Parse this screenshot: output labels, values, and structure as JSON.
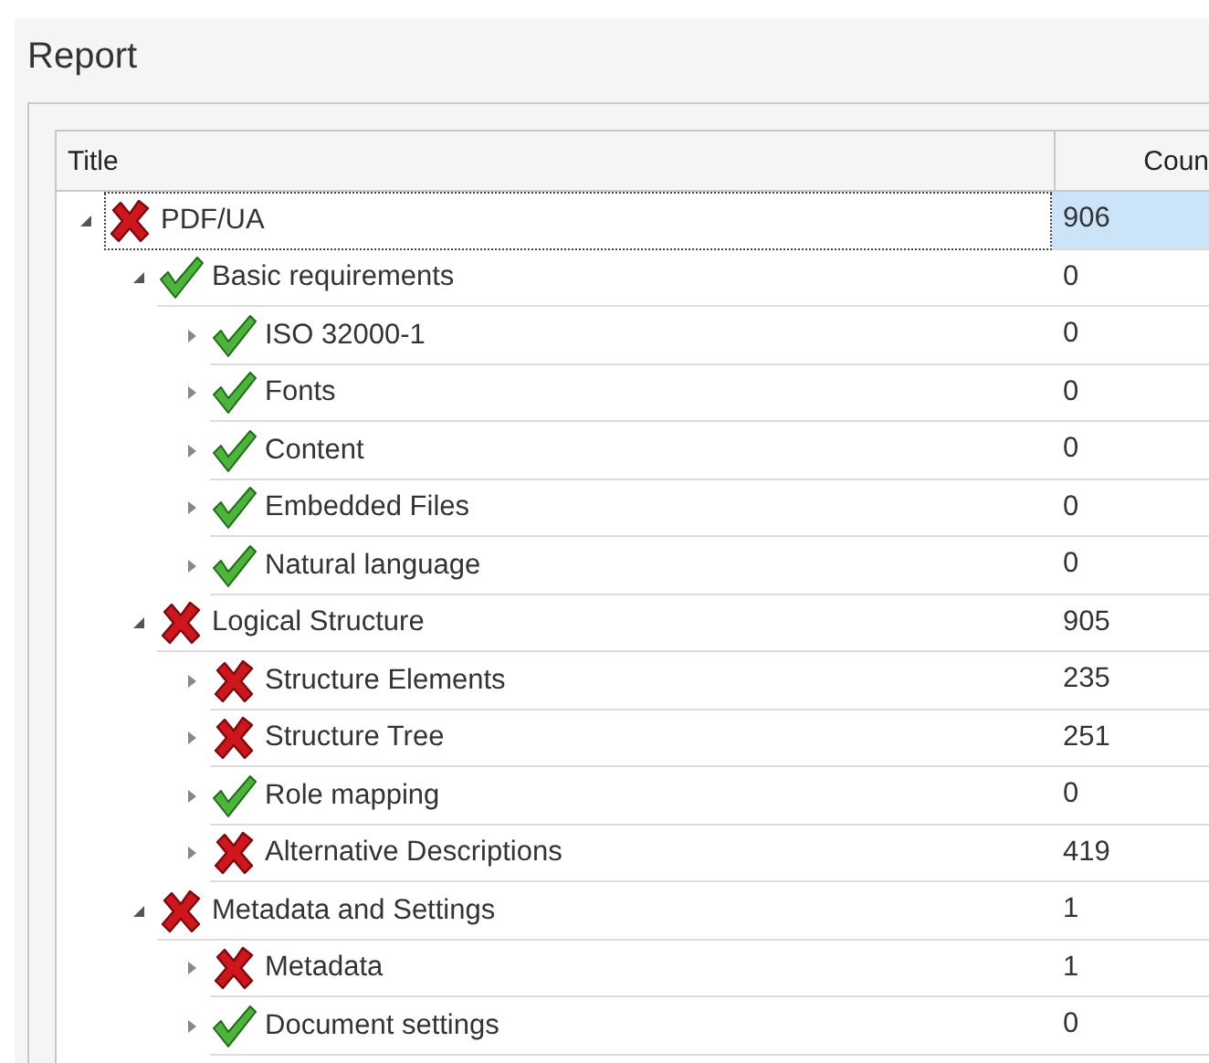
{
  "panel": {
    "title": "Report"
  },
  "table": {
    "columns": [
      "Title",
      "Coun"
    ],
    "tree": [
      {
        "title": "PDF/UA",
        "count": "906",
        "kind": "fail",
        "expanded": true,
        "selected": true,
        "children": [
          {
            "title": "Basic requirements",
            "count": "0",
            "kind": "pass",
            "expanded": true,
            "selected": false,
            "children": [
              {
                "title": "ISO 32000-1",
                "count": "0",
                "kind": "pass",
                "expanded": false,
                "selected": false
              },
              {
                "title": "Fonts",
                "count": "0",
                "kind": "pass",
                "expanded": false,
                "selected": false
              },
              {
                "title": "Content",
                "count": "0",
                "kind": "pass",
                "expanded": false,
                "selected": false
              },
              {
                "title": "Embedded Files",
                "count": "0",
                "kind": "pass",
                "expanded": false,
                "selected": false
              },
              {
                "title": "Natural language",
                "count": "0",
                "kind": "pass",
                "expanded": false,
                "selected": false
              }
            ]
          },
          {
            "title": "Logical Structure",
            "count": "905",
            "kind": "fail",
            "expanded": true,
            "selected": false,
            "children": [
              {
                "title": "Structure Elements",
                "count": "235",
                "kind": "fail",
                "expanded": false,
                "selected": false
              },
              {
                "title": "Structure Tree",
                "count": "251",
                "kind": "fail",
                "expanded": false,
                "selected": false
              },
              {
                "title": "Role mapping",
                "count": "0",
                "kind": "pass",
                "expanded": false,
                "selected": false
              },
              {
                "title": "Alternative Descriptions",
                "count": "419",
                "kind": "fail",
                "expanded": false,
                "selected": false
              }
            ]
          },
          {
            "title": "Metadata and Settings",
            "count": "1",
            "kind": "fail",
            "expanded": true,
            "selected": false,
            "children": [
              {
                "title": "Metadata",
                "count": "1",
                "kind": "fail",
                "expanded": false,
                "selected": false
              },
              {
                "title": "Document settings",
                "count": "0",
                "kind": "pass",
                "expanded": false,
                "selected": false
              }
            ]
          }
        ]
      }
    ]
  }
}
